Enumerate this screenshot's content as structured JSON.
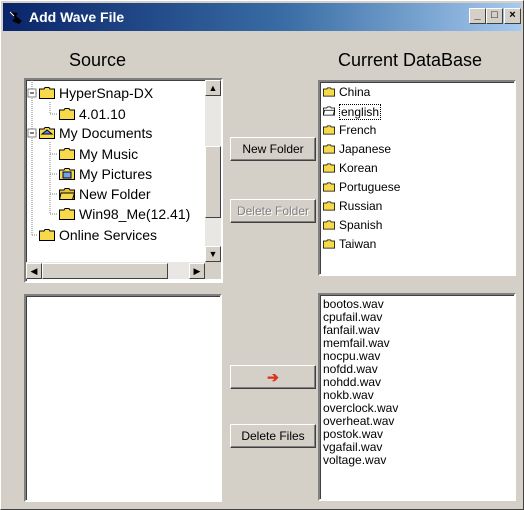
{
  "window": {
    "title": "Add Wave File",
    "minimize": "_",
    "maximize": "□",
    "close": "×"
  },
  "source": {
    "heading": "Source",
    "tree": [
      {
        "label": "HyperSnap-DX",
        "icon": "folder-icon"
      },
      {
        "label": "4.01.10",
        "icon": "folder-icon"
      },
      {
        "label": "My Documents",
        "icon": "documents-folder-icon"
      },
      {
        "label": "My Music",
        "icon": "folder-icon"
      },
      {
        "label": "My Pictures",
        "icon": "pictures-folder-icon"
      },
      {
        "label": "New Folder",
        "icon": "folder-open-icon"
      },
      {
        "label": "Win98_Me(12.41)",
        "icon": "folder-icon"
      },
      {
        "label": "Online Services",
        "icon": "folder-icon"
      }
    ]
  },
  "database": {
    "heading": "Current DataBase",
    "folders": [
      "China",
      "english",
      "French",
      "Japanese",
      "Korean",
      "Portuguese",
      "Russian",
      "Spanish",
      "Taiwan"
    ],
    "selected_folder": "english",
    "files": [
      "bootos.wav",
      "cpufail.wav",
      "fanfail.wav",
      "memfail.wav",
      "nocpu.wav",
      "nofdd.wav",
      "nohdd.wav",
      "nokb.wav",
      "overclock.wav",
      "overheat.wav",
      "postok.wav",
      "vgafail.wav",
      "voltage.wav"
    ]
  },
  "buttons": {
    "new_folder": "New Folder",
    "delete_folder": "Delete Folder",
    "add_arrow": "➔",
    "delete_files": "Delete Files"
  },
  "colors": {
    "folder": "#f7d94c",
    "arrow": "#e03020"
  }
}
